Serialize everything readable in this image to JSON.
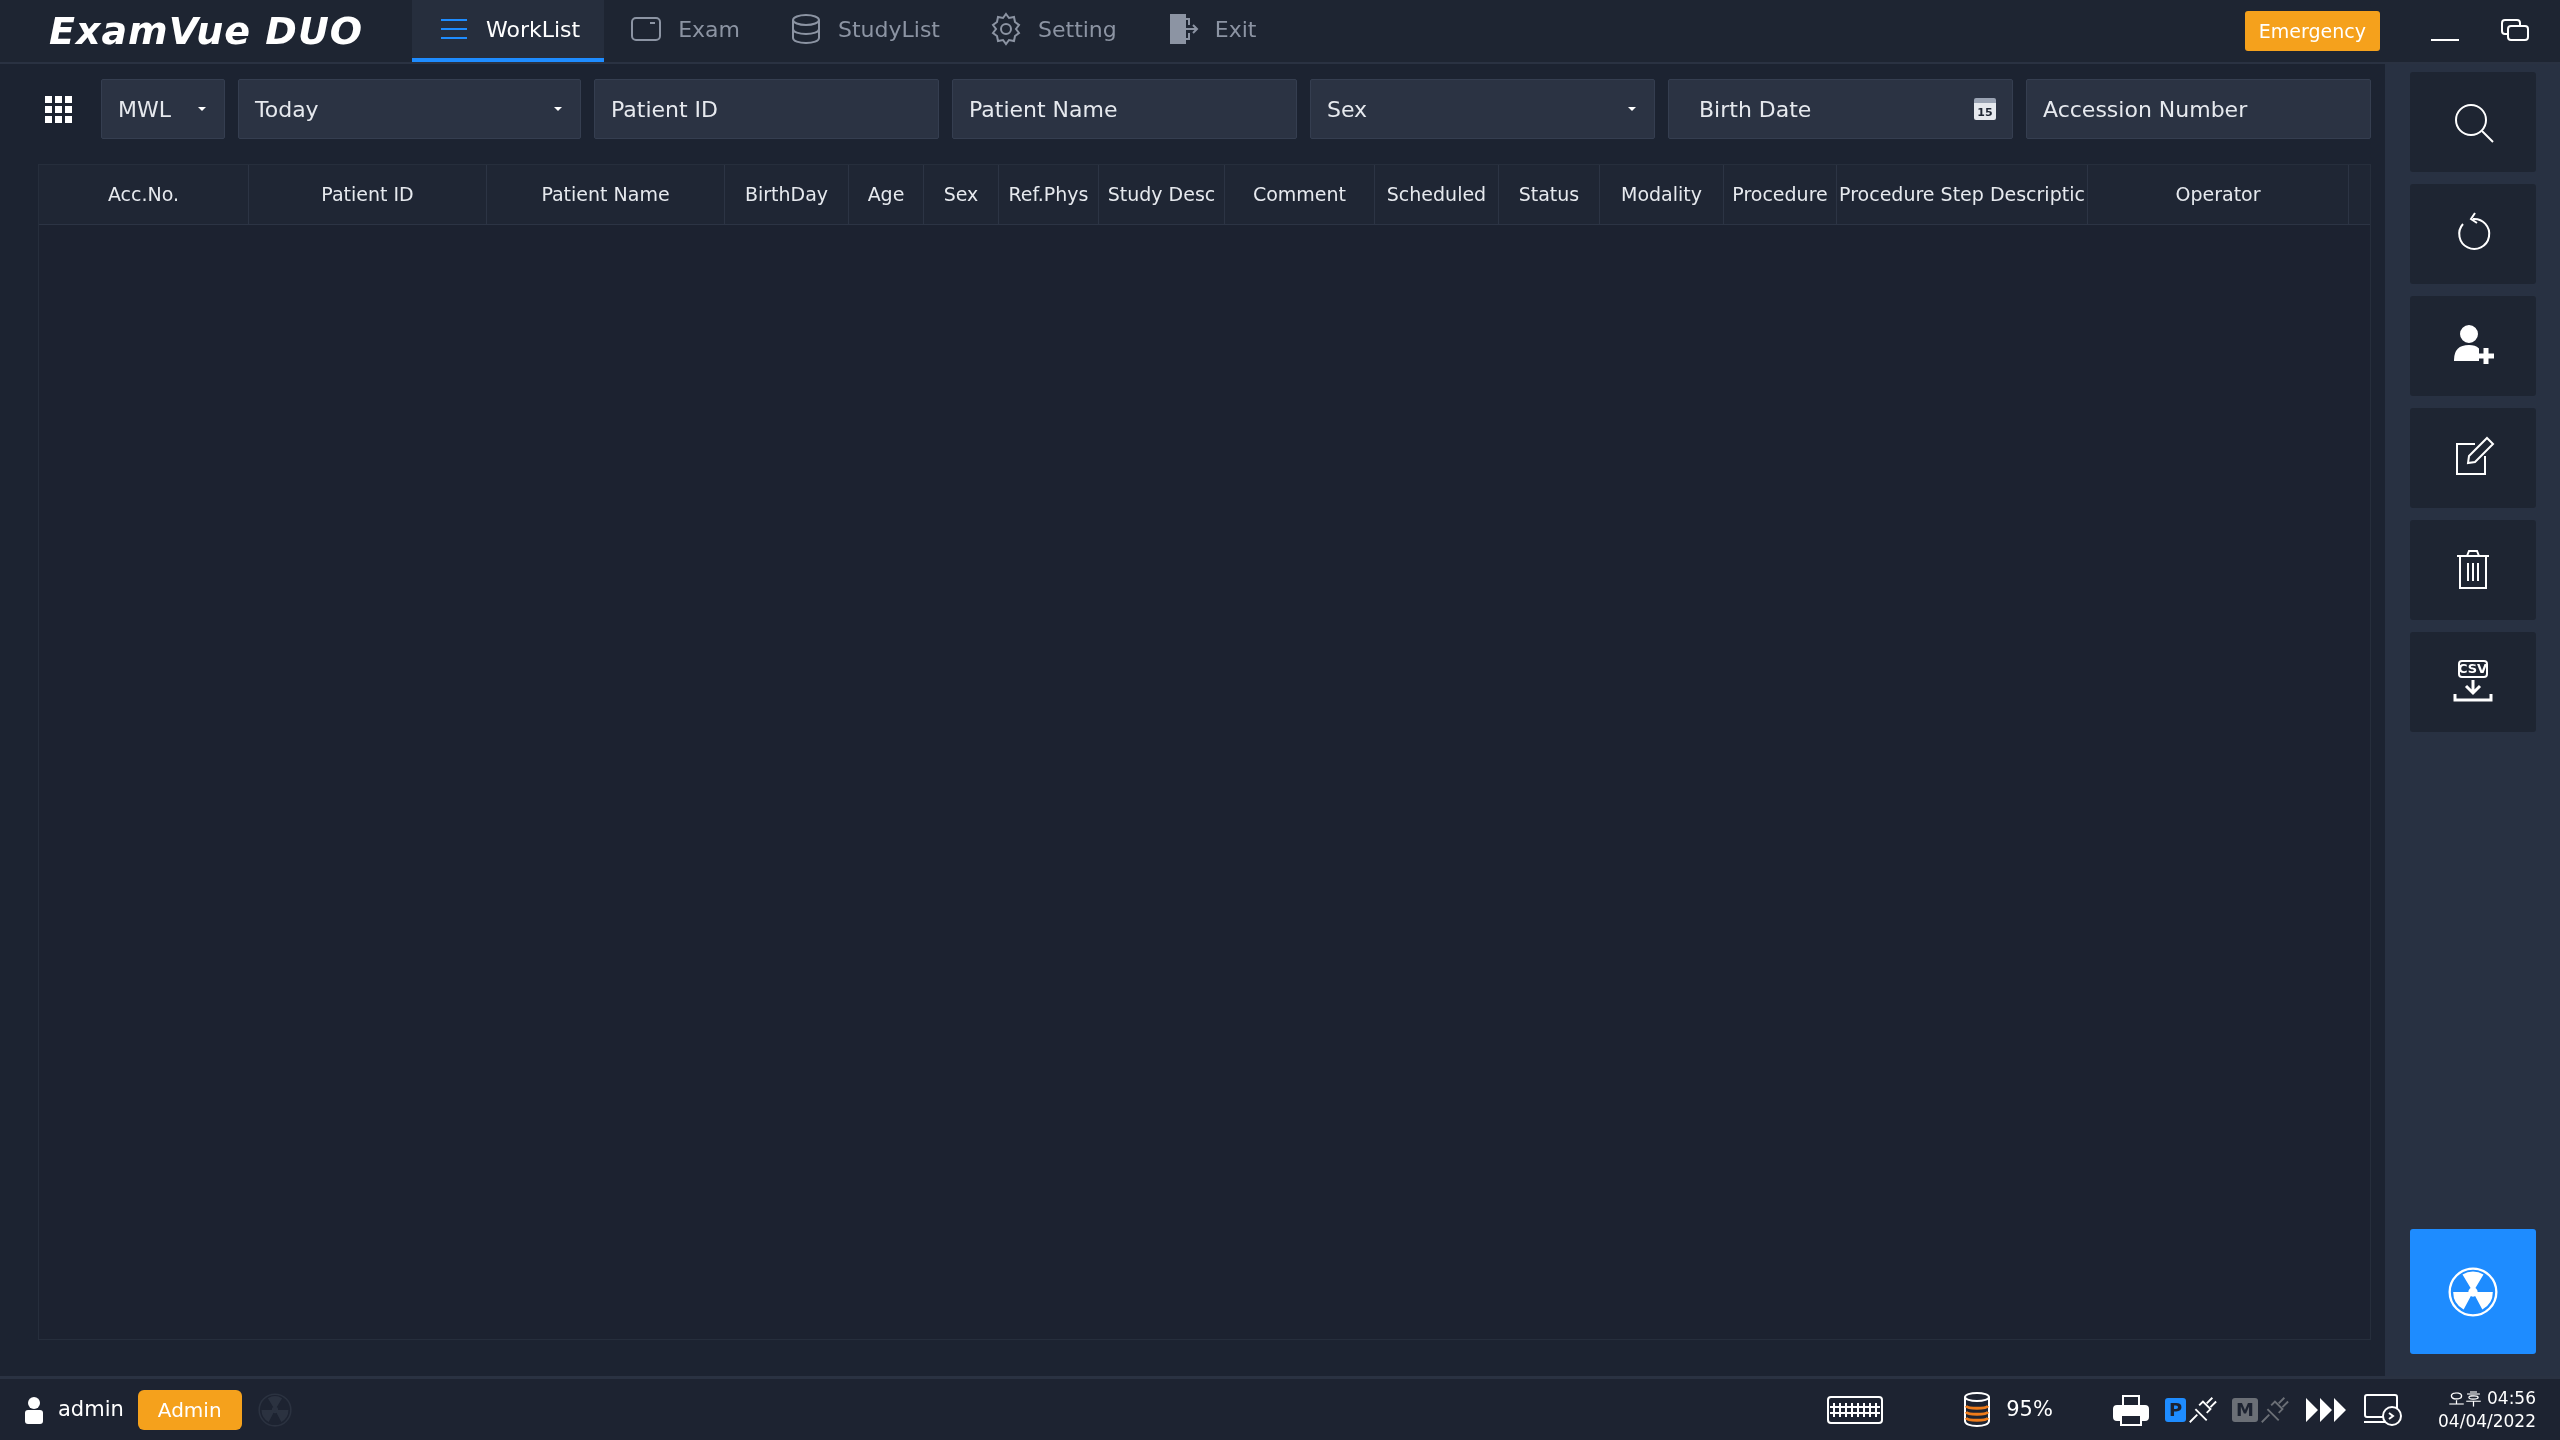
{
  "app": {
    "logo": "ExamVue DUO"
  },
  "nav_tabs": [
    {
      "label": "WorkList",
      "kind": "list",
      "selected": true
    },
    {
      "label": "Exam",
      "kind": "exam",
      "selected": false
    },
    {
      "label": "StudyList",
      "kind": "database",
      "selected": false
    },
    {
      "label": "Setting",
      "kind": "gear",
      "selected": false
    },
    {
      "label": "Exit",
      "kind": "exit",
      "selected": false
    }
  ],
  "emergency_button": "Emergency",
  "filters": {
    "source": "MWL",
    "date_range": "Today",
    "patient_id": {
      "placeholder": "Patient ID"
    },
    "patient_name": {
      "placeholder": "Patient Name"
    },
    "sex": "Sex",
    "birth_date": {
      "placeholder": "Birth Date"
    },
    "calendar_day": "15",
    "accession_number": {
      "placeholder": "Accession Number"
    }
  },
  "table": {
    "columns": [
      "Acc.No.",
      "Patient ID",
      "Patient Name",
      "BirthDay",
      "Age",
      "Sex",
      "Ref.Phys",
      "Study Desc",
      "Comment",
      "Scheduled",
      "Status",
      "Modality",
      "Procedure",
      "Procedure Step Descriptic",
      "Operator"
    ]
  },
  "sidebar": {
    "buttons": [
      {
        "kind": "search"
      },
      {
        "kind": "refresh"
      },
      {
        "kind": "add-patient"
      },
      {
        "kind": "edit"
      },
      {
        "kind": "delete"
      },
      {
        "kind": "csv",
        "label": "CSV"
      }
    ],
    "expose_button": {
      "kind": "radiation"
    }
  },
  "status_bar": {
    "user": "admin",
    "role": "Admin",
    "storage": "95%",
    "connections": [
      {
        "label": "P",
        "connected": true
      },
      {
        "label": "M",
        "connected": false
      }
    ],
    "time": "오후 04:56",
    "date": "04/04/2022"
  }
}
